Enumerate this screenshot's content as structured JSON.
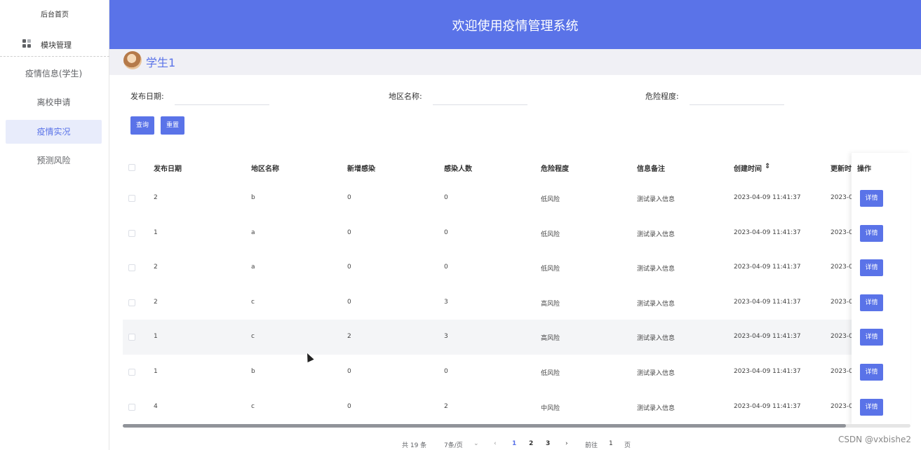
{
  "sidebar": {
    "home": "后台首页",
    "module": "模块管理",
    "items": [
      {
        "label": "疫情信息(学生)",
        "active": false
      },
      {
        "label": "离校申请",
        "active": false
      },
      {
        "label": "疫情实况",
        "active": true
      },
      {
        "label": "预测风险",
        "active": false
      }
    ]
  },
  "header": {
    "title": "欢迎使用疫情管理系统"
  },
  "user": {
    "name": "学生1"
  },
  "filters": {
    "date_label": "发布日期:",
    "date_value": "",
    "region_label": "地区名称:",
    "region_value": "",
    "risk_label": "危险程度:",
    "risk_value": "",
    "search_button": "查询",
    "reset_button": "重置"
  },
  "table": {
    "columns": [
      "发布日期",
      "地区名称",
      "新增感染",
      "感染人数",
      "危险程度",
      "信息备注",
      "创建时间",
      "更新时间",
      "操作"
    ],
    "rows": [
      [
        "2",
        "b",
        "0",
        "0",
        "低风险",
        "测试录入信息",
        "2023-04-09 11:41:37",
        "2023-0"
      ],
      [
        "1",
        "a",
        "0",
        "0",
        "低风险",
        "测试录入信息",
        "2023-04-09 11:41:37",
        "2023-0"
      ],
      [
        "2",
        "a",
        "0",
        "0",
        "低风险",
        "测试录入信息",
        "2023-04-09 11:41:37",
        "2023-0"
      ],
      [
        "2",
        "c",
        "0",
        "3",
        "高风险",
        "测试录入信息",
        "2023-04-09 11:41:37",
        "2023-0"
      ],
      [
        "1",
        "c",
        "2",
        "3",
        "高风险",
        "测试录入信息",
        "2023-04-09 11:41:37",
        "2023-0"
      ],
      [
        "1",
        "b",
        "0",
        "0",
        "低风险",
        "测试录入信息",
        "2023-04-09 11:41:37",
        "2023-0"
      ],
      [
        "4",
        "c",
        "0",
        "2",
        "中风险",
        "测试录入信息",
        "2023-04-09 11:41:37",
        "2023-0"
      ]
    ],
    "detail_button": "详情",
    "highlighted_row": 4
  },
  "pagination": {
    "total": "共 19 条",
    "page_size": "7条/页",
    "pages": [
      "1",
      "2",
      "3"
    ],
    "current_page": "1",
    "goto_label": "前往",
    "goto_value": "1",
    "page_suffix": "页"
  },
  "watermark": "CSDN @vxbishe2",
  "colors": {
    "primary": "#5a73e8",
    "sidebar_active_bg": "#e8ecfb"
  }
}
